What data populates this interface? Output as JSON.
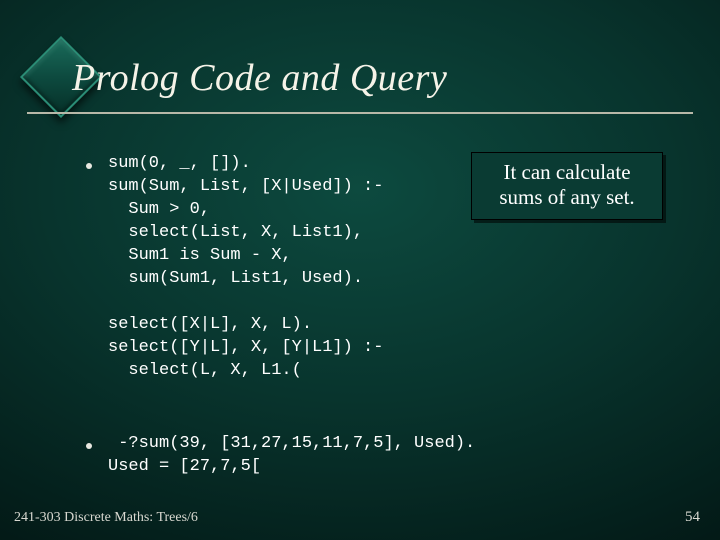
{
  "title": "Prolog Code and Query",
  "callout": "It can calculate sums of any set.",
  "code": {
    "block1": "sum(0, _, []).\nsum(Sum, List, [X|Used]) :-\n  Sum > 0,\n  select(List, X, List1),\n  Sum1 is Sum - X,\n  sum(Sum1, List1, Used).",
    "block2": "select([X|L], X, L).\nselect([Y|L], X, [Y|L1]) :-\n  select(L, X, L1.(",
    "block3": " -?sum(39, [31,27,15,11,7,5], Used).\nUsed = [27,7,5["
  },
  "footer": {
    "left": "241-303 Discrete Maths: Trees/6",
    "page": "54"
  }
}
